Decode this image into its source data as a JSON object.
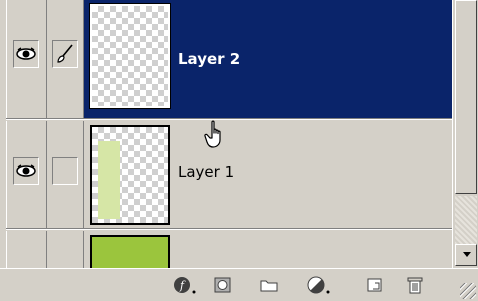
{
  "layers": [
    {
      "name": "Layer 2",
      "selected": true,
      "visible_icon": "eye-icon",
      "link_icon": "brush-icon"
    },
    {
      "name": "Layer 1",
      "selected": false,
      "visible_icon": "eye-icon",
      "link_icon": ""
    },
    {
      "name": "",
      "selected": false,
      "visible_icon": "",
      "link_icon": ""
    }
  ],
  "toolbar": {
    "buttons": [
      "layer-style-icon",
      "layer-mask-icon",
      "new-group-icon",
      "adjustment-layer-icon",
      "new-layer-icon",
      "trash-icon"
    ]
  },
  "colors": {
    "selection": "#0a246a",
    "panel": "#d4d0c8",
    "fill_layer": "#9bc53d",
    "layer1_content": "#d6e6a6"
  },
  "cursor": "hand-pointer-icon"
}
